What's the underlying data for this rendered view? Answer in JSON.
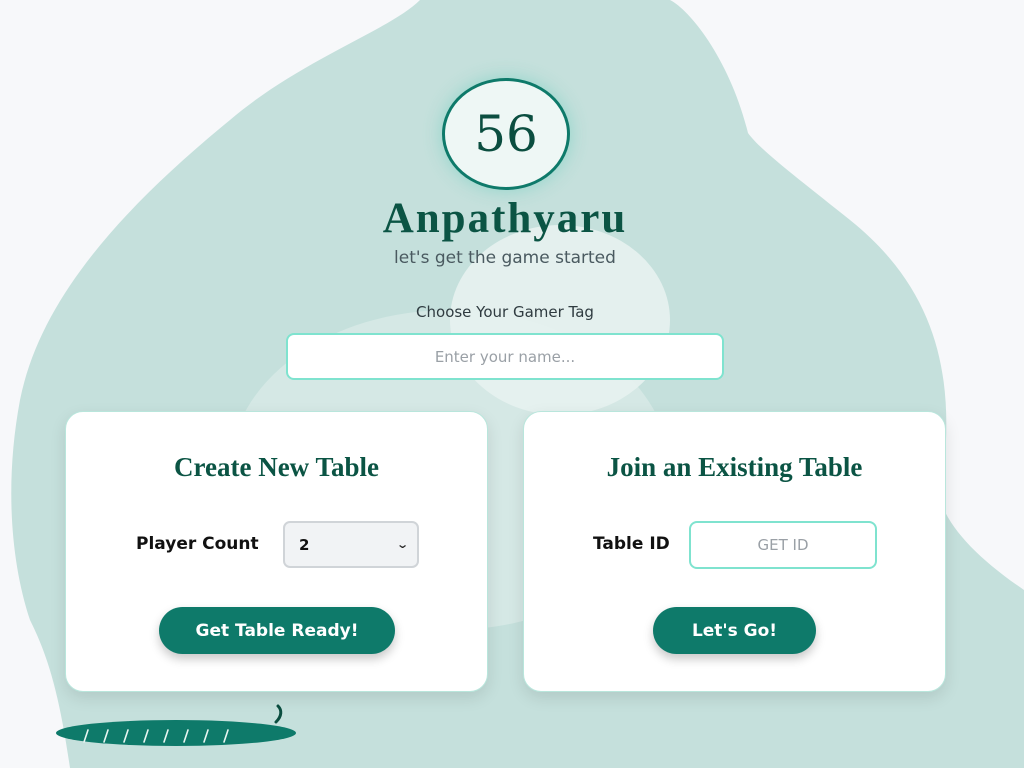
{
  "logo": {
    "text": "56"
  },
  "app": {
    "title": "Anpathyaru",
    "subtitle": "let's get the game started"
  },
  "gamer_tag": {
    "label": "Choose Your Gamer Tag",
    "placeholder": "Enter your name...",
    "value": ""
  },
  "create_table": {
    "title": "Create New Table",
    "player_count_label": "Player Count",
    "player_count_selected": "2",
    "button_label": "Get Table Ready!"
  },
  "join_table": {
    "title": "Join an Existing Table",
    "table_id_label": "Table ID",
    "table_id_placeholder": "GET ID",
    "table_id_value": "",
    "button_label": "Let's Go!"
  },
  "icons": {
    "dropdown": "chevron-down-icon",
    "decoration": "leaf-icon"
  },
  "colors": {
    "primary": "#0e7a6a",
    "heading": "#0b5444",
    "accent_border": "#7fe3cf",
    "background_blob": "#c5e0dc",
    "page_background": "#f7f8fa"
  }
}
